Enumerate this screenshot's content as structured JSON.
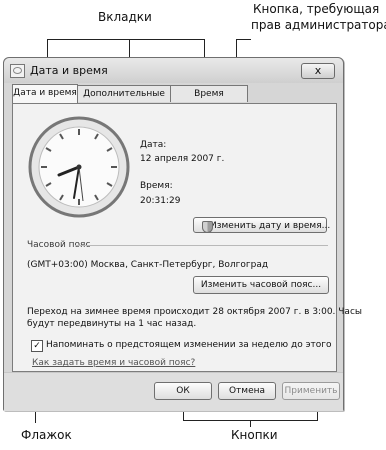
{
  "annotations": {
    "tabs_label": "Вкладки",
    "admin_button_label_line1": "Кнопка, требующая",
    "admin_button_label_line2": "прав администратора",
    "checkbox_label": "Флажок",
    "buttons_label": "Кнопки"
  },
  "window": {
    "title": "Дата и время",
    "close_glyph": "x"
  },
  "tabs": [
    {
      "label": "Дата и время",
      "active": true
    },
    {
      "label": "Дополнительные часы",
      "active": false
    },
    {
      "label": "Время Интернета",
      "active": false
    }
  ],
  "date_time": {
    "date_label": "Дата:",
    "date_value": "12 апреля 2007 г.",
    "time_label": "Время:",
    "time_value": "20:31:29",
    "change_button": "Изменить дату и время..."
  },
  "timezone": {
    "section_label": "Часовой пояс",
    "value": "(GMT+03:00) Москва, Санкт-Петербург, Волгоград",
    "change_button": "Изменить часовой пояс..."
  },
  "dst": {
    "line1": "Переход на зимнее время происходит 28 октября 2007 г. в 3:00. Часы",
    "line2": "будут передвинуты на 1 час назад.",
    "reminder_label": "Напоминать о предстоящем изменении за неделю до этого",
    "reminder_checked": true,
    "help_link": "Как задать время и часовой пояс?"
  },
  "footer": {
    "ok": "ОК",
    "cancel": "Отмена",
    "apply": "Применить"
  },
  "colors": {
    "window_bg": "#d6d6d6",
    "panel_bg": "#f2f2f2"
  }
}
